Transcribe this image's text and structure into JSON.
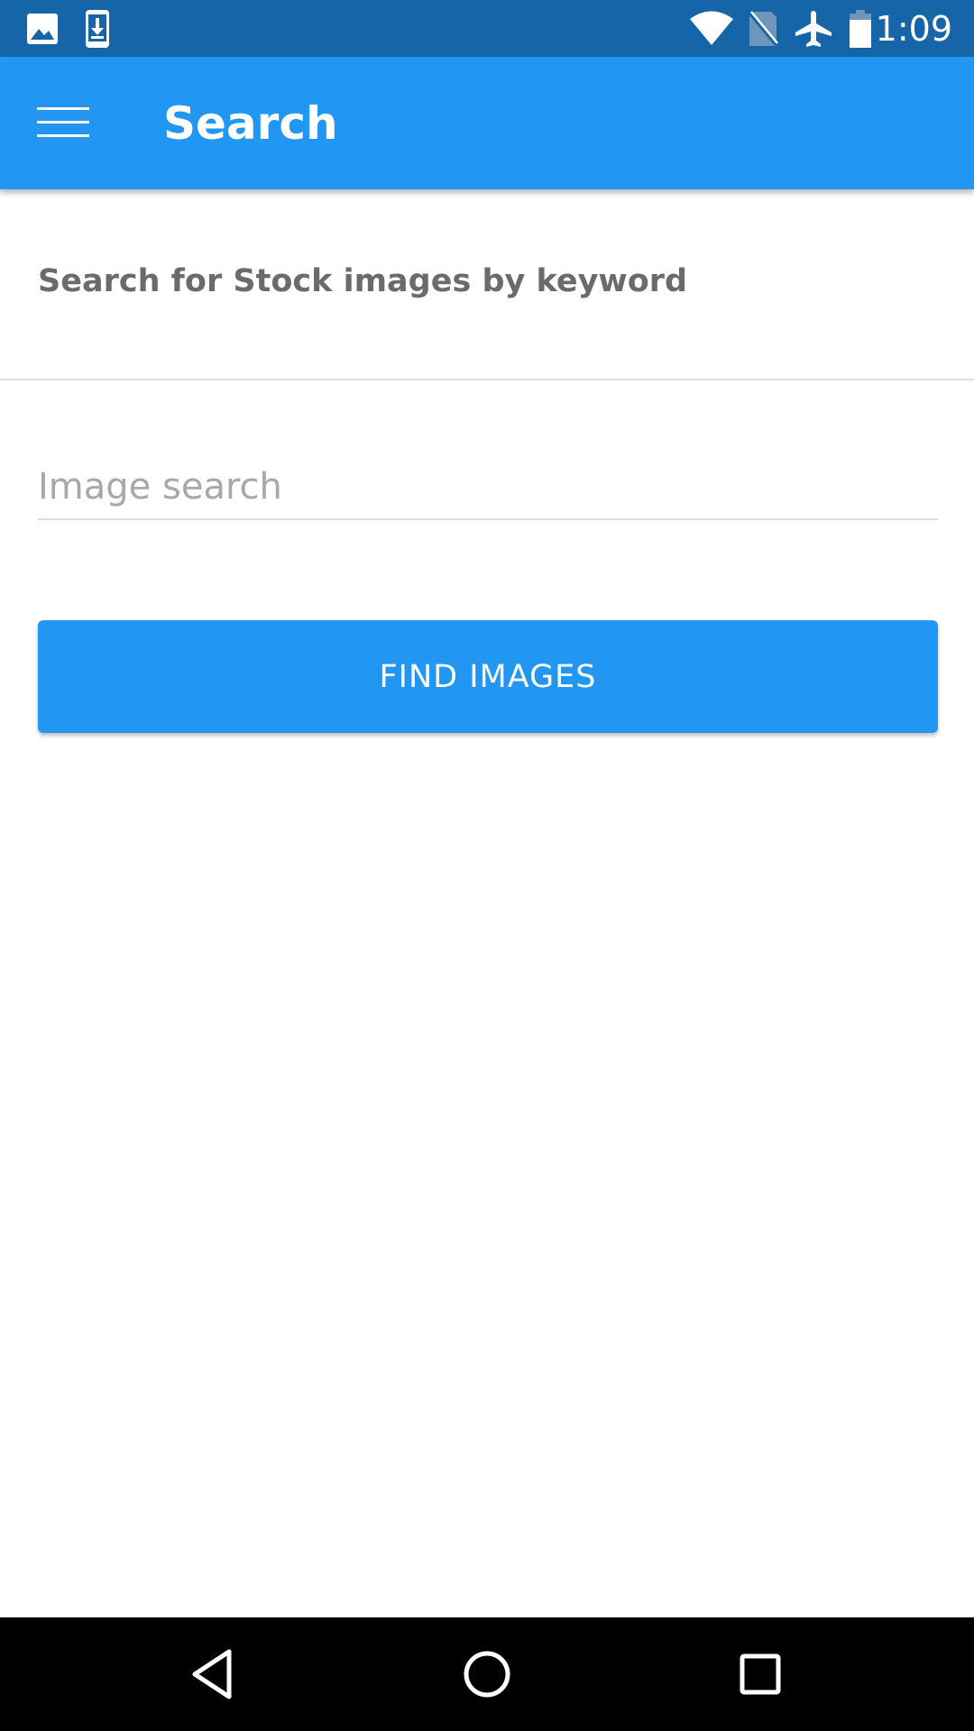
{
  "status_bar": {
    "time": "1:09",
    "left_icons": [
      "image-icon",
      "download-icon"
    ],
    "right_icons": [
      "wifi-icon",
      "no-sim-icon",
      "airplane-icon",
      "battery-icon"
    ],
    "background": "#1565a8"
  },
  "app_bar": {
    "title": "Search",
    "menu_icon": "hamburger-menu-icon",
    "background": "#2196f3"
  },
  "main": {
    "subtitle": "Search for Stock images by keyword",
    "search": {
      "placeholder": "Image search",
      "value": ""
    },
    "find_button_label": "FIND IMAGES",
    "accent": "#2196f3"
  },
  "nav_bar": {
    "buttons": [
      "back-icon",
      "home-icon",
      "recents-icon"
    ]
  }
}
